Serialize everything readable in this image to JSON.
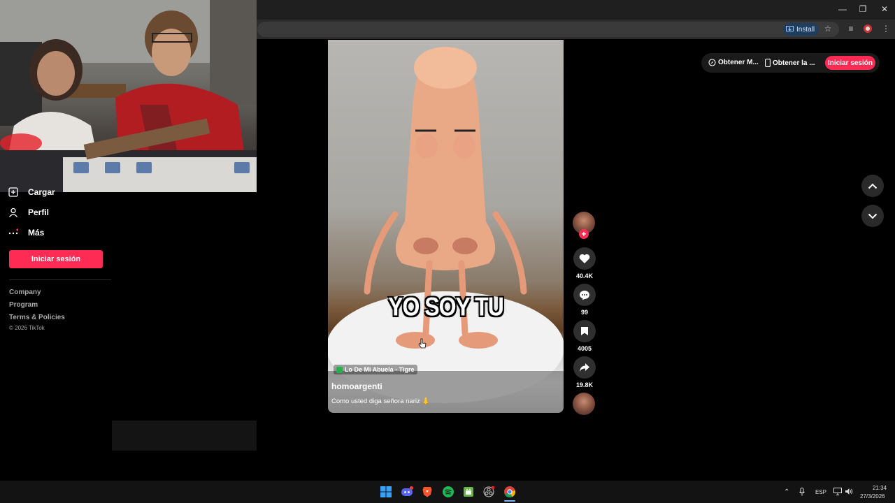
{
  "browser": {
    "install_label": "Install",
    "window_controls": [
      "—",
      "❐",
      "✕"
    ]
  },
  "sidebar": {
    "items": [
      {
        "label": "Cargar",
        "icon": "upload-icon"
      },
      {
        "label": "Perfil",
        "icon": "person-icon"
      },
      {
        "label": "Más",
        "icon": "more-icon"
      }
    ],
    "login_button": "Iniciar sesión",
    "footer_links": [
      "Company",
      "Program",
      "Terms & Policies"
    ],
    "copyright": "© 2026 TikTok"
  },
  "video": {
    "caption_overlay": "YO SOY TU",
    "location": "Lo De Mi Abuela - Tigre",
    "username": "homoargenti",
    "description": "Como usted diga señora nariz 👃"
  },
  "actions": {
    "likes": "40.4K",
    "comments": "99",
    "saves": "4005",
    "shares": "19.8K"
  },
  "topbar": {
    "get_mini": "Obtener M...",
    "get_app": "Obtener la ...",
    "login": "Iniciar sesión"
  },
  "taskbar": {
    "language": "ESP",
    "time": "21:34",
    "date": "27/3/2026"
  },
  "colors": {
    "accent": "#fe2c55",
    "background": "#000000"
  }
}
